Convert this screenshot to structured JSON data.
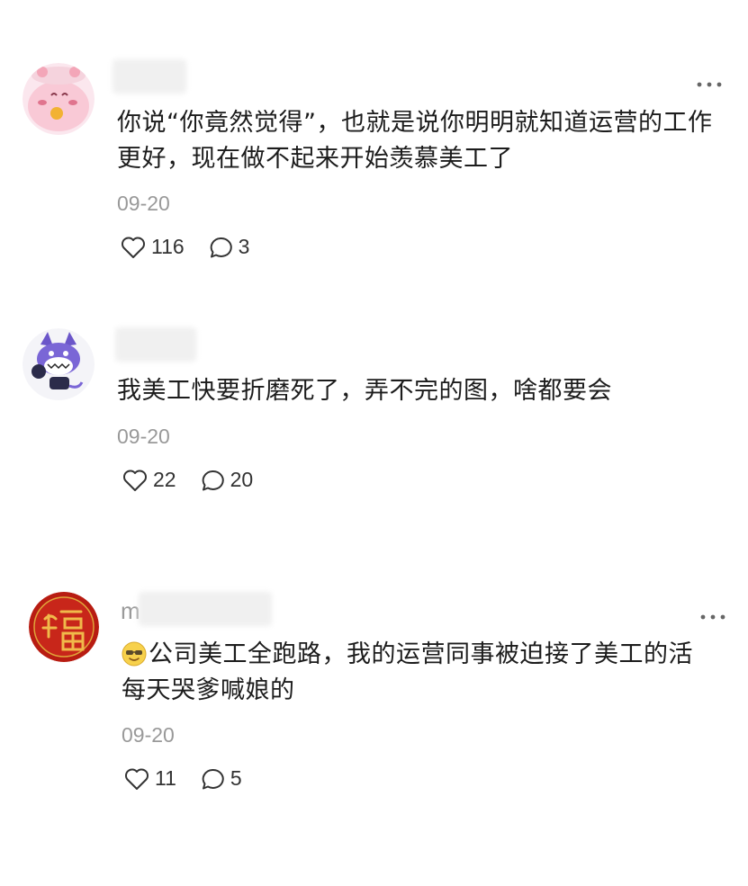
{
  "comments": [
    {
      "username_prefix": "",
      "avatar": "pink-cartoon-avatar-icon",
      "text_lines": [
        "你说“你竟然觉得”，也就是说你明明就知道运营的工作",
        "更好，现在做不起来开始羡慕美工了"
      ],
      "date": "09-20",
      "likes": "116",
      "replies": "3"
    },
    {
      "username_prefix": "",
      "avatar": "purple-cat-cartoon-avatar-icon",
      "text_lines": [
        "我美工快要折磨死了，弄不完的图，啥都要会"
      ],
      "date": "09-20",
      "likes": "22",
      "replies": "20"
    },
    {
      "username_prefix": "m",
      "avatar": "red-fu-character-avatar-icon",
      "emoji": "smiling-sunglasses-emoji-icon",
      "text_lines": [
        "公司美工全跑路，我的运营同事被迫接了美工的活",
        "每天哭爹喊娘的"
      ],
      "date": "09-20",
      "likes": "11",
      "replies": "5"
    }
  ],
  "icons": {
    "more": "more-dots-icon",
    "like": "heart-outline-icon",
    "reply": "speech-bubble-icon"
  },
  "colors": {
    "text": "#1c1c1c",
    "meta": "#999999",
    "icon": "#333333"
  }
}
